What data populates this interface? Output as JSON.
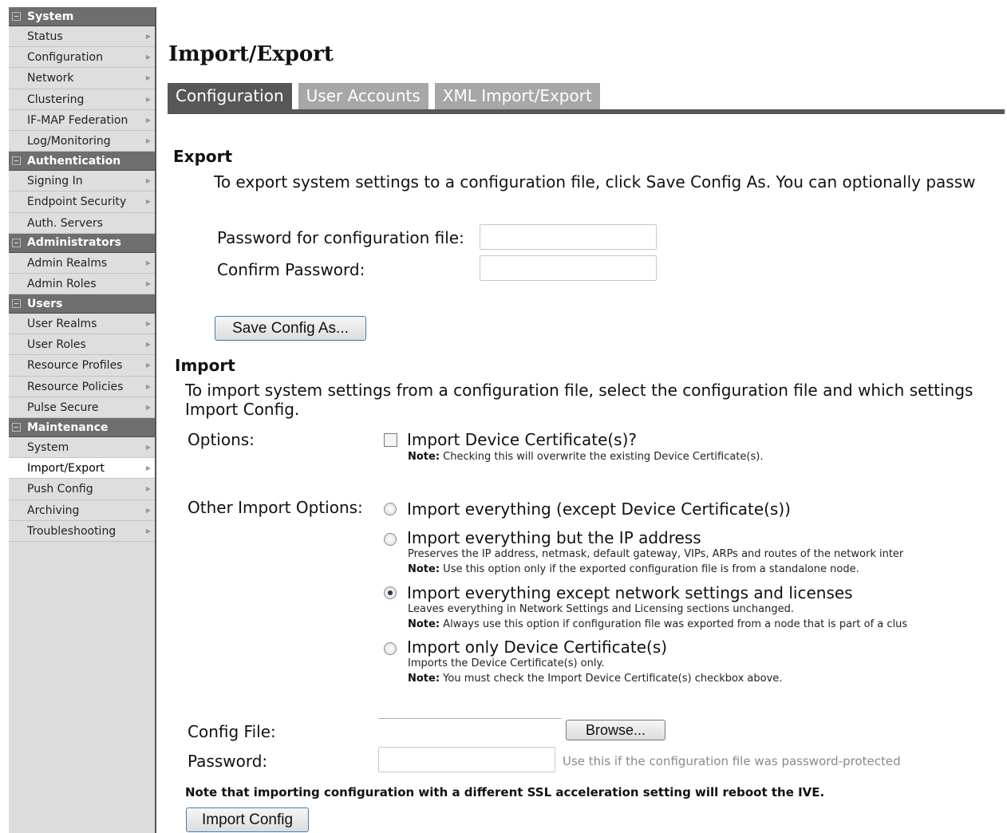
{
  "sidebar": {
    "sections": [
      {
        "title": "System",
        "items": [
          "Status",
          "Configuration",
          "Network",
          "Clustering",
          "IF-MAP Federation",
          "Log/Monitoring"
        ]
      },
      {
        "title": "Authentication",
        "items": [
          "Signing In",
          "Endpoint Security",
          "Auth. Servers"
        ]
      },
      {
        "title": "Administrators",
        "items": [
          "Admin Realms",
          "Admin Roles"
        ]
      },
      {
        "title": "Users",
        "items": [
          "User Realms",
          "User Roles",
          "Resource Profiles",
          "Resource Policies",
          "Pulse Secure"
        ]
      },
      {
        "title": "Maintenance",
        "items": [
          "System",
          "Import/Export",
          "Push Config",
          "Archiving",
          "Troubleshooting"
        ]
      }
    ],
    "active_item": "Import/Export"
  },
  "page": {
    "title": "Import/Export",
    "tabs": [
      "Configuration",
      "User Accounts",
      "XML Import/Export"
    ],
    "active_tab": "Configuration"
  },
  "export": {
    "heading": "Export",
    "description": "To export system settings to a configuration file, click Save Config As. You can optionally passw",
    "password_label": "Password for configuration file:",
    "password_value": "",
    "confirm_label": "Confirm Password:",
    "confirm_value": "",
    "save_button": "Save Config As..."
  },
  "import": {
    "heading": "Import",
    "description_line1": "To import system settings from a configuration file, select the configuration file and which settings",
    "description_line2": "Import Config.",
    "options_label": "Options:",
    "device_cert_checkbox": {
      "label": "Import Device Certificate(s)?",
      "note_bold": "Note:",
      "note": " Checking this will overwrite the existing Device Certificate(s).",
      "checked": false
    },
    "other_options_label": "Other Import Options:",
    "radio_options": [
      {
        "label": "Import everything (except Device Certificate(s))",
        "checked": false
      },
      {
        "label": "Import everything but the IP address",
        "desc": "Preserves the IP address, netmask, default gateway, VIPs, ARPs and routes of the network inter",
        "note_bold": "Note:",
        "note": " Use this option only if the exported configuration file is from a standalone node.",
        "checked": false
      },
      {
        "label": "Import everything except network settings and licenses",
        "desc": "Leaves everything in Network Settings and Licensing sections unchanged.",
        "note_bold": "Note:",
        "note": " Always use this option if configuration file was exported from a node that is part of a clus",
        "checked": true
      },
      {
        "label": "Import only Device Certificate(s)",
        "desc": "Imports the Device Certificate(s) only.",
        "note_bold": "Note:",
        "note": " You must check the Import Device Certificate(s) checkbox above.",
        "checked": false
      }
    ],
    "config_file_label": "Config File:",
    "browse_button": "Browse...",
    "password_label": "Password:",
    "password_value": "",
    "password_hint": "Use this if the configuration file was password-protected",
    "reboot_note": "Note that importing configuration with a different SSL acceleration setting will reboot the IVE.",
    "import_button": "Import Config"
  }
}
